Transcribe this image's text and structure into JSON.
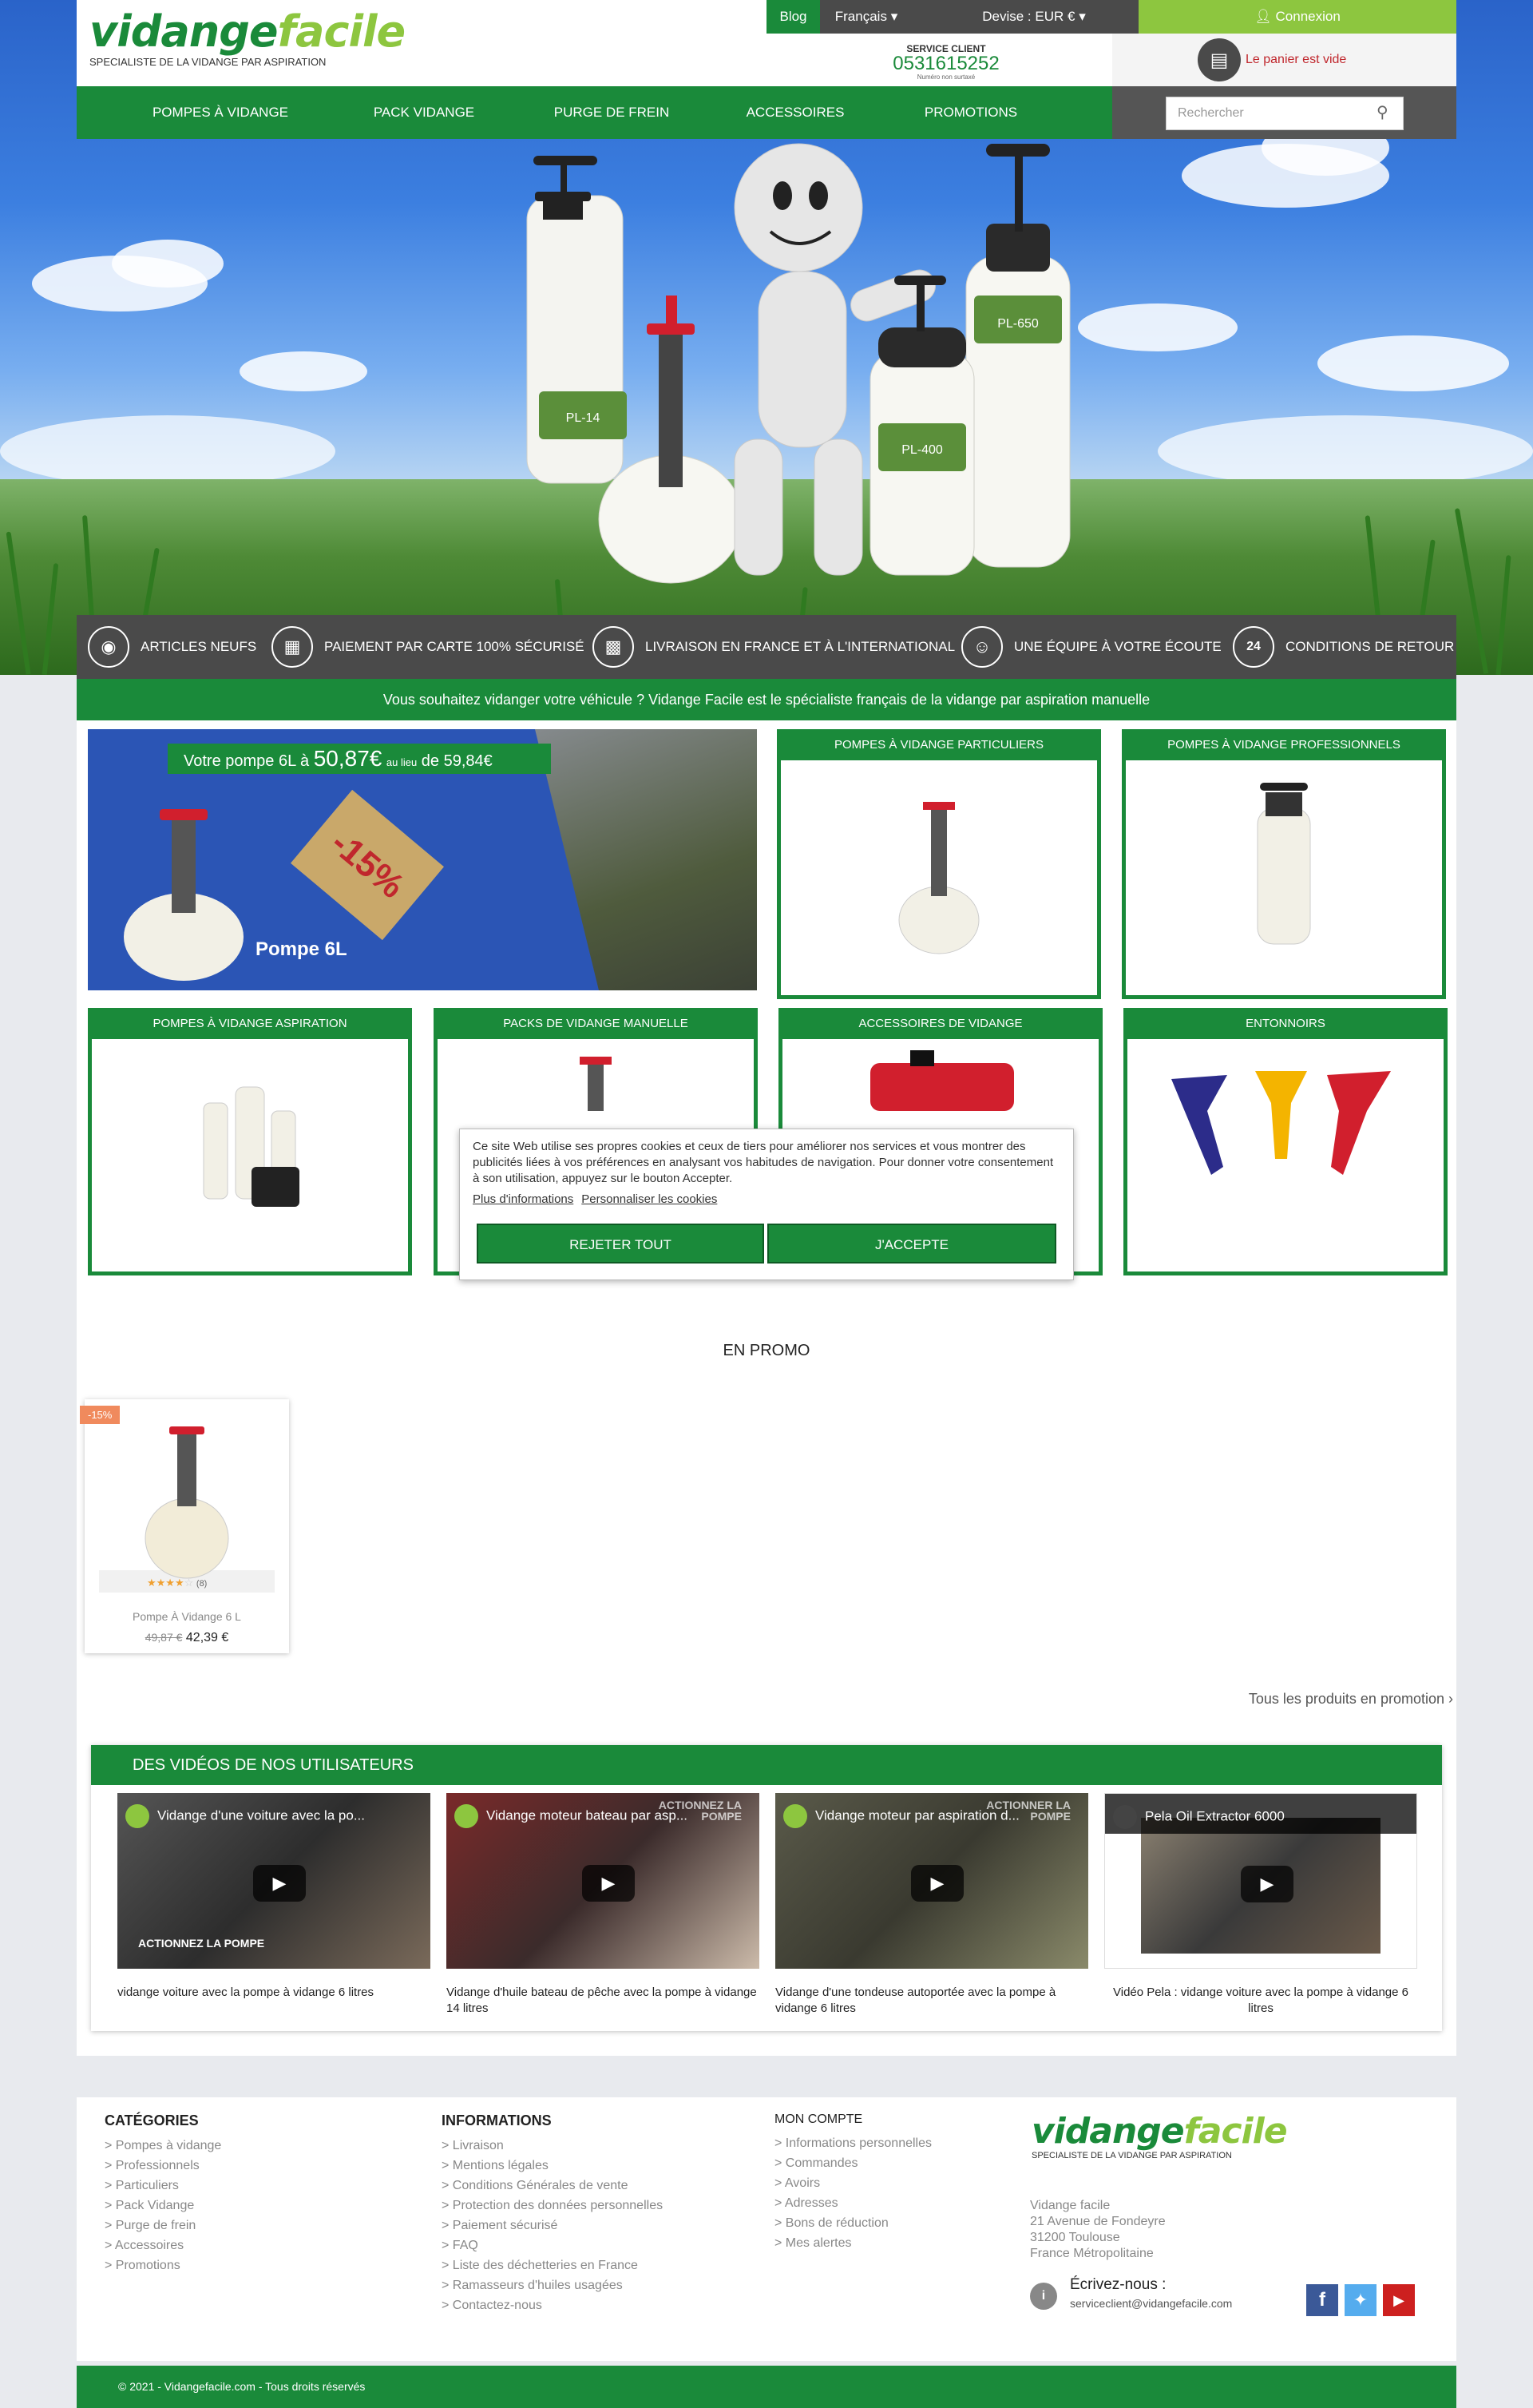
{
  "header": {
    "logo": {
      "main": "vidange",
      "accent": "facile",
      "tagline": "SPECIALISTE DE LA VIDANGE PAR ASPIRATION"
    },
    "top_links": {
      "blog": "Blog",
      "language": "Français",
      "currency": "Devise : EUR €",
      "login": "Connexion"
    },
    "service": {
      "label": "SERVICE CLIENT",
      "phone": "0531615252",
      "note": "Numéro non surtaxé"
    },
    "cart": "Le panier est vide",
    "search_placeholder": "Rechercher"
  },
  "nav": [
    "POMPES À VIDANGE",
    "PACK VIDANGE",
    "PURGE DE FREIN",
    "ACCESSOIRES",
    "PROMOTIONS"
  ],
  "hero": {
    "labels": [
      "PL-14",
      "PL-650",
      "PL-400"
    ]
  },
  "reassurance": [
    {
      "icon": "medal-icon",
      "label": "ARTICLES NEUFS"
    },
    {
      "icon": "credit-card-icon",
      "label": "PAIEMENT PAR CARTE 100% SÉCURISÉ"
    },
    {
      "icon": "truck-icon",
      "label": "LIVRAISON EN FRANCE ET À L'INTERNATIONAL"
    },
    {
      "icon": "headset-icon",
      "label": "UNE ÉQUIPE À VOTRE ÉCOUTE"
    },
    {
      "icon": "24h-icon",
      "label": "CONDITIONS DE RETOUR"
    }
  ],
  "tagline": "Vous souhaitez vidanger votre véhicule ? Vidange Facile est le spécialiste français de la vidange par aspiration manuelle",
  "promo_banner": {
    "text_pre": "Votre pompe 6L à",
    "price": "50,87€",
    "mid": "au lieu",
    "text_post": "de 59,84€",
    "discount": "-15%",
    "product": "Pompe 6L"
  },
  "categories": [
    "POMPES À VIDANGE PARTICULIERS",
    "POMPES À VIDANGE PROFESSIONNELS",
    "POMPES À VIDANGE ASPIRATION",
    "PACKS DE VIDANGE MANUELLE",
    "ACCESSOIRES DE VIDANGE",
    "ENTONNOIRS"
  ],
  "cookie": {
    "text": "Ce site Web utilise ses propres cookies et ceux de tiers pour améliorer nos services et vous montrer des publicités liées à vos préférences en analysant vos habitudes de navigation. Pour donner votre consentement à son utilisation, appuyez sur le bouton Accepter.",
    "more_info": "Plus d'informations",
    "customize": "Personnaliser les cookies",
    "reject": "REJETER TOUT",
    "accept": "J'ACCEPTE"
  },
  "promo_section": {
    "title": "EN PROMO",
    "product": {
      "badge": "-15%",
      "reviews": "(8)",
      "name": "Pompe À Vidange 6 L",
      "old_price": "49,87 €",
      "price": "42,39 €",
      "rating": 4
    },
    "all_link": "Tous les produits en promotion"
  },
  "videos": {
    "title": "DES VIDÉOS DE NOS UTILISATEURS",
    "items": [
      {
        "video_title": "Vidange d'une voiture avec la po...",
        "overlay": "ACTIONNEZ LA POMPE",
        "caption": "vidange voiture avec la pompe à vidange 6 litres"
      },
      {
        "video_title": "Vidange moteur bateau par asp...",
        "overlay": "ACTIONNEZ LA POMPE",
        "caption": "Vidange d'huile bateau de pêche avec la pompe à vidange 14 litres"
      },
      {
        "video_title": "Vidange moteur par aspiration d...",
        "overlay": "ACTIONNER LA POMPE",
        "caption": "Vidange d'une tondeuse autoportée avec la pompe à vidange 6 litres"
      },
      {
        "video_title": "Pela Oil Extractor 6000",
        "overlay": "",
        "caption": "Vidéo Pela : vidange voiture avec la pompe à vidange 6 litres"
      }
    ]
  },
  "footer": {
    "categories": {
      "title": "CATÉGORIES",
      "items": [
        "Pompes à vidange",
        "Professionnels",
        "Particuliers",
        "Pack Vidange",
        "Purge de frein",
        "Accessoires",
        "Promotions"
      ]
    },
    "informations": {
      "title": "INFORMATIONS",
      "items": [
        "Livraison",
        "Mentions légales",
        "Conditions Générales de vente",
        "Protection des données personnelles",
        "Paiement sécurisé",
        "FAQ",
        "Liste des déchetteries en France",
        "Ramasseurs d'huiles usagées",
        "Contactez-nous"
      ]
    },
    "account": {
      "title": "MON COMPTE",
      "items": [
        "Informations personnelles",
        "Commandes",
        "Avoirs",
        "Adresses",
        "Bons de réduction",
        "Mes alertes"
      ]
    },
    "address": [
      "Vidange facile",
      "21 Avenue de Fondeyre",
      "31200 Toulouse",
      "France Métropolitaine"
    ],
    "write_label": "Écrivez-nous :",
    "email": "serviceclient@vidangefacile.com",
    "copyright": "© 2021 - Vidangefacile.com - Tous droits réservés"
  },
  "colors": {
    "primary": "#1a8a3a",
    "accent": "#8dc63f",
    "dark": "#4a4a4a",
    "badge": "#f08a5d"
  }
}
